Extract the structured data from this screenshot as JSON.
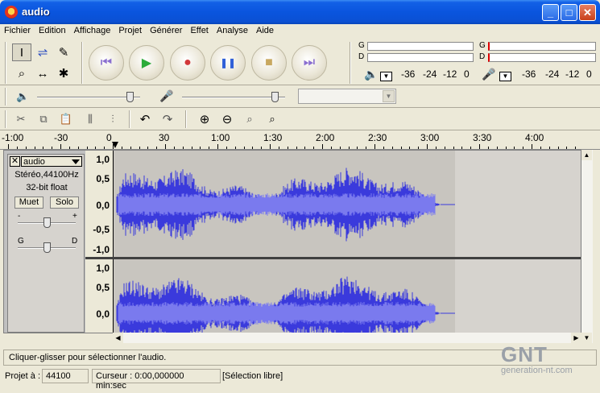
{
  "window": {
    "title": "audio",
    "minimize": "_",
    "maximize": "□",
    "close": "✕"
  },
  "menu": [
    "Fichier",
    "Edition",
    "Affichage",
    "Projet",
    "Générer",
    "Effet",
    "Analyse",
    "Aide"
  ],
  "tools": {
    "select": "I",
    "envelope": "⇌",
    "draw": "✎",
    "zoom": "⌕",
    "timeshift": "↔",
    "multi": "✱"
  },
  "transport": {
    "rewind": "⏮",
    "play": "▶",
    "record": "●",
    "pause": "❚❚",
    "stop": "■",
    "forward": "⏭"
  },
  "meters": {
    "left_label": "G",
    "right_label": "D",
    "scale": [
      "-36",
      "-24",
      "-12",
      "0"
    ],
    "speaker_icon": "speaker-icon",
    "mic_icon": "microphone-icon"
  },
  "mixer": {
    "output_volume": 0.9,
    "input_volume": 0.9,
    "input_source": ""
  },
  "edit_tools": [
    "cut",
    "copy",
    "paste",
    "trim",
    "silence",
    "undo",
    "redo",
    "zoom-in",
    "zoom-out",
    "fit-selection",
    "fit-project"
  ],
  "edit_glyphs": {
    "undo": "↶",
    "redo": "↷",
    "zoom_in": "⊕",
    "zoom_out": "⊖"
  },
  "ruler": [
    "-1:00",
    "-30",
    "0",
    "30",
    "1:00",
    "1:30",
    "2:00",
    "2:30",
    "3:00",
    "3:30",
    "4:00"
  ],
  "track": {
    "name": "audio",
    "format": "Stéréo,44100Hz",
    "sample": "32-bit float",
    "mute": "Muet",
    "solo": "Solo",
    "gain_minus": "-",
    "gain_plus": "+",
    "pan_left": "G",
    "pan_right": "D",
    "gain": 0.5,
    "pan": 0.5,
    "vruler_top": [
      "1,0",
      "0,5",
      "0,0",
      "-0,5",
      "-1,0"
    ],
    "vruler_bottom": [
      "1,0",
      "0,5",
      "0,0"
    ]
  },
  "status": {
    "message": "Cliquer-glisser pour sélectionner l'audio.",
    "project_rate_label": "Projet à :",
    "project_rate": "44100",
    "cursor": "Curseur : 0:00,000000 min:sec",
    "selection": "[Sélection libre]"
  },
  "watermark": {
    "logo": "GNT",
    "url": "generation-nt.com"
  }
}
